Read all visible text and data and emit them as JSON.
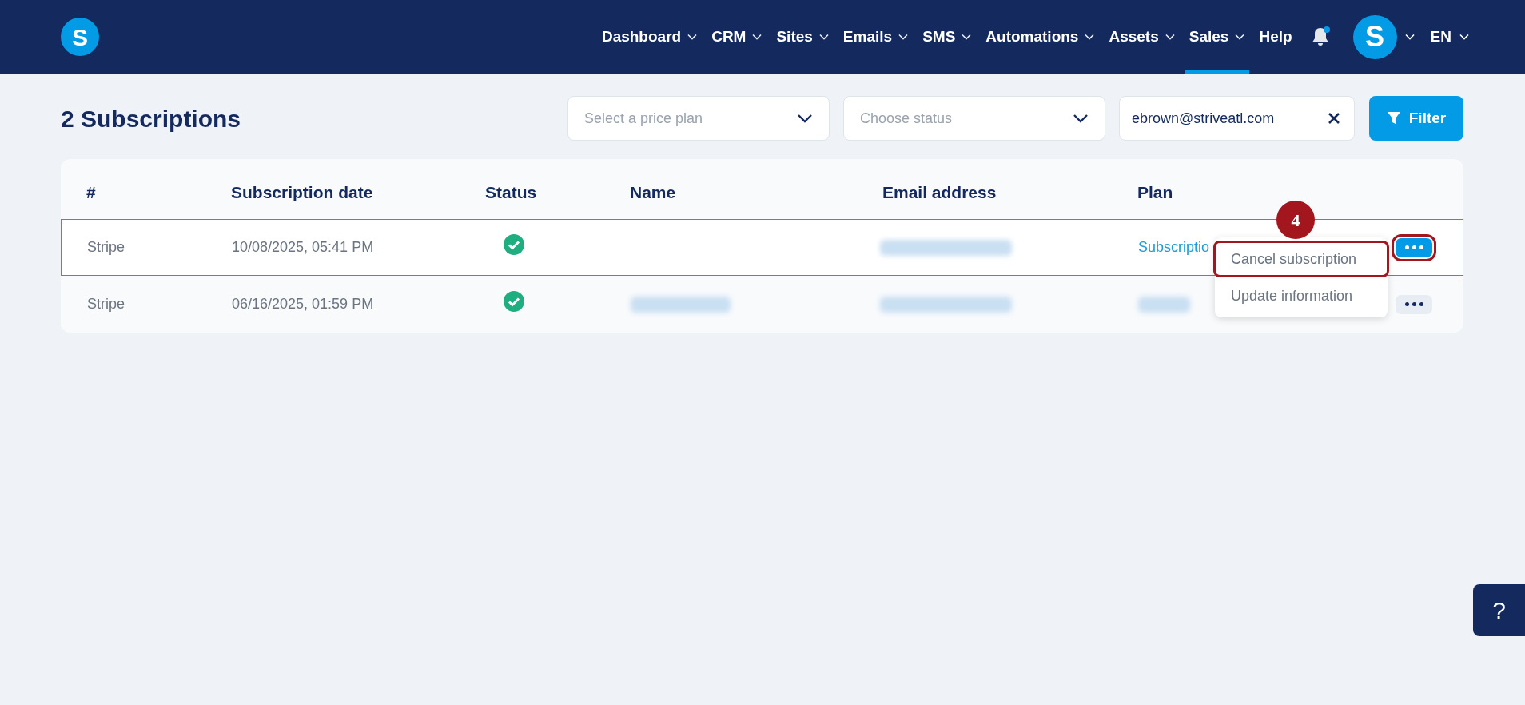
{
  "nav": {
    "items": [
      {
        "label": "Dashboard",
        "has_menu": true,
        "selected": false
      },
      {
        "label": "CRM",
        "has_menu": true,
        "selected": false
      },
      {
        "label": "Sites",
        "has_menu": true,
        "selected": false
      },
      {
        "label": "Emails",
        "has_menu": true,
        "selected": false
      },
      {
        "label": "SMS",
        "has_menu": true,
        "selected": false
      },
      {
        "label": "Automations",
        "has_menu": true,
        "selected": false
      },
      {
        "label": "Assets",
        "has_menu": true,
        "selected": false
      },
      {
        "label": "Sales",
        "has_menu": true,
        "selected": true
      },
      {
        "label": "Help",
        "has_menu": false,
        "selected": false
      }
    ],
    "notification_dot": true,
    "logo_letter": "S",
    "avatar_letter": "S",
    "language": "EN"
  },
  "page_title": "2 Subscriptions",
  "filters": {
    "price_plan": {
      "placeholder": "Select a price plan"
    },
    "status": {
      "placeholder": "Choose status"
    },
    "email": {
      "value": "ebrown@striveatl.com"
    },
    "button": "Filter"
  },
  "table": {
    "columns": [
      "#",
      "Subscription date",
      "Status",
      "Name",
      "Email address",
      "Plan"
    ],
    "rows": [
      {
        "source": "Stripe",
        "date": "10/08/2025, 05:41 PM",
        "active": true,
        "name_redacted": false,
        "email_redacted": true,
        "plan": "Subscriptio",
        "plan_redacted": false,
        "selected": true,
        "actions_highlighted": true
      },
      {
        "source": "Stripe",
        "date": "06/16/2025, 01:59 PM",
        "active": true,
        "name_redacted": true,
        "email_redacted": true,
        "plan_redacted": true,
        "selected": false,
        "actions_highlighted": false
      }
    ]
  },
  "action_menu": {
    "items": [
      {
        "label": "Cancel subscription",
        "highlighted": true
      },
      {
        "label": "Update information",
        "highlighted": false
      }
    ]
  },
  "step_badge": "4",
  "help_button": "?"
}
